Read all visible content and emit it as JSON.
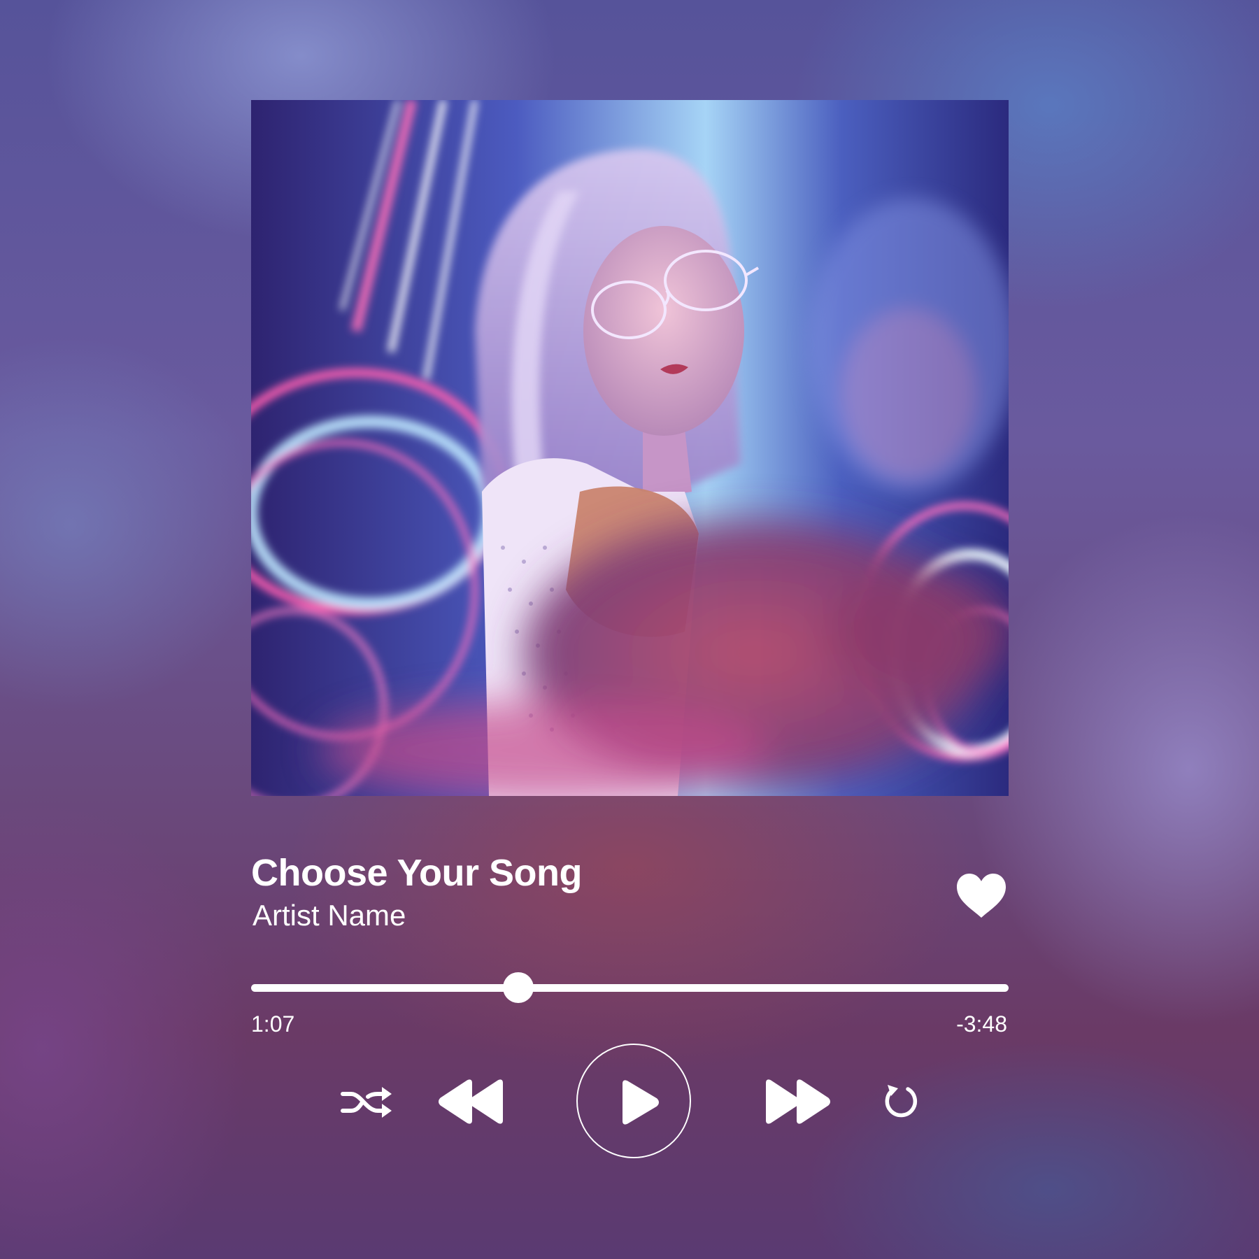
{
  "player": {
    "song_title": "Choose Your Song",
    "artist": "Artist Name",
    "time_elapsed": "1:07",
    "time_remaining": "-3:48",
    "progress_fraction": 0.353,
    "liked": true
  },
  "controls": {
    "shuffle_icon": "shuffle-icon",
    "rewind_icon": "rewind-icon",
    "play_icon": "play-icon",
    "forward_icon": "fast-forward-icon",
    "repeat_icon": "repeat-icon",
    "like_icon": "heart-icon"
  },
  "colors": {
    "foreground": "#ffffff"
  }
}
